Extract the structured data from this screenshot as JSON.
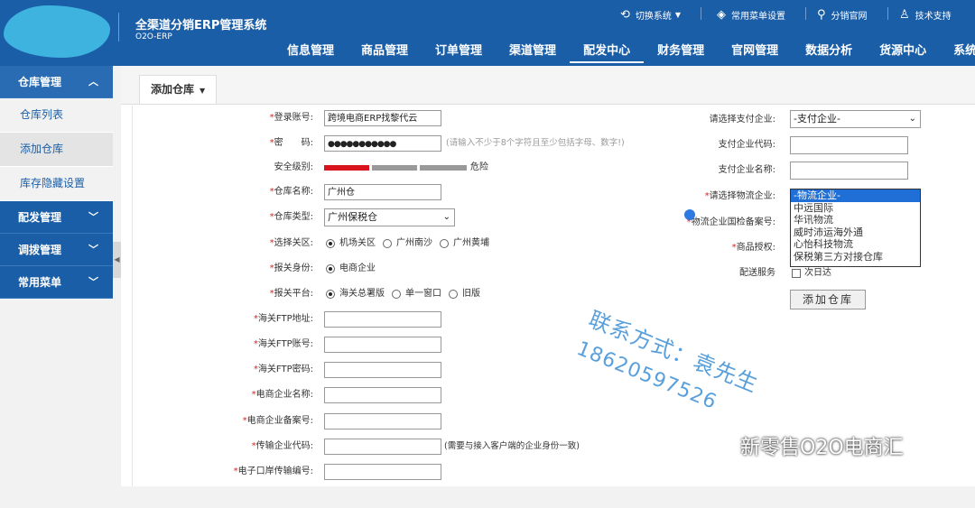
{
  "header": {
    "title": "全渠道分销ERP管理系统",
    "subtitle": "O2O-ERP",
    "links": [
      {
        "label": "切换系统",
        "icon": "switch-icon"
      },
      {
        "label": "常用菜单设置",
        "icon": "layers-icon"
      },
      {
        "label": "分销官网",
        "icon": "network-icon"
      },
      {
        "label": "技术支持",
        "icon": "user-icon"
      }
    ],
    "nav": [
      "信息管理",
      "商品管理",
      "订单管理",
      "渠道管理",
      "配发中心",
      "财务管理",
      "官网管理",
      "数据分析",
      "货源中心",
      "系统管"
    ],
    "active_nav": "配发中心"
  },
  "sidebar": {
    "groups": [
      {
        "label": "仓库管理",
        "open": true,
        "items": [
          "仓库列表",
          "添加仓库",
          "库存隐藏设置"
        ]
      },
      {
        "label": "配发管理",
        "open": false,
        "items": []
      },
      {
        "label": "调拨管理",
        "open": false,
        "items": []
      },
      {
        "label": "常用菜单",
        "open": false,
        "items": []
      }
    ],
    "active_item": "添加仓库"
  },
  "tab": {
    "label": "添加仓库"
  },
  "form": {
    "left": {
      "account": {
        "label": "*登录账号:",
        "value": "跨境电商ERP找黎代云"
      },
      "password": {
        "label": "*密　　码:",
        "value": "●●●●●●●●●●●",
        "hint": "(请输入不少于8个字符且至少包括字母、数字!)"
      },
      "security": {
        "label": "安全级别:",
        "level_text": "危险",
        "level": 1,
        "colors": [
          "#d9131b",
          "#999999",
          "#999999"
        ]
      },
      "warehouse_name": {
        "label": "*仓库名称:",
        "value": "广州仓"
      },
      "warehouse_type": {
        "label": "*仓库类型:",
        "value": "广州保税仓"
      },
      "customs_area": {
        "label": "*选择关区:",
        "options": [
          "机场关区",
          "广州南沙",
          "广州黄埔"
        ],
        "selected": 0
      },
      "declare_identity": {
        "label": "*报关身份:",
        "options": [
          "电商企业"
        ],
        "selected": 0
      },
      "declare_platform": {
        "label": "*报关平台:",
        "options": [
          "海关总署版",
          "单一窗口",
          "旧版"
        ],
        "selected": 0
      },
      "ftp_addr": {
        "label": "*海关FTP地址:",
        "value": ""
      },
      "ftp_account": {
        "label": "*海关FTP账号:",
        "value": ""
      },
      "ftp_password": {
        "label": "*海关FTP密码:",
        "value": ""
      },
      "ec_name": {
        "label": "*电商企业名称:",
        "value": ""
      },
      "ec_record": {
        "label": "*电商企业备案号:",
        "value": ""
      },
      "transfer_code": {
        "label": "*传输企业代码:",
        "value": "",
        "hint": "(需要与接入客户端的企业身份一致)"
      },
      "port_code": {
        "label": "*电子口岸传输编号:",
        "value": ""
      }
    },
    "right": {
      "pay_company": {
        "label": "请选择支付企业:",
        "value": "-支付企业-"
      },
      "pay_code": {
        "label": "支付企业代码:",
        "value": ""
      },
      "pay_name": {
        "label": "支付企业名称:",
        "value": ""
      },
      "logistics": {
        "label": "*请选择物流企业:",
        "options": [
          "-物流企业-",
          "中远国际",
          "华讯物流",
          "威时沛运海外通",
          "心怡科技物流",
          "保税第三方对接仓库"
        ],
        "selected": 0
      },
      "logistics_record": {
        "label": "*物流企业国检备案号:"
      },
      "goods_auth": {
        "label": "*商品授权:"
      },
      "delivery": {
        "label": "配送服务",
        "option": "次日达"
      },
      "submit": "添加仓库"
    }
  },
  "watermark": {
    "line1": "联系方式：袁先生",
    "line2": "18620597526"
  },
  "wechat_mark": "新零售O2O电商汇"
}
